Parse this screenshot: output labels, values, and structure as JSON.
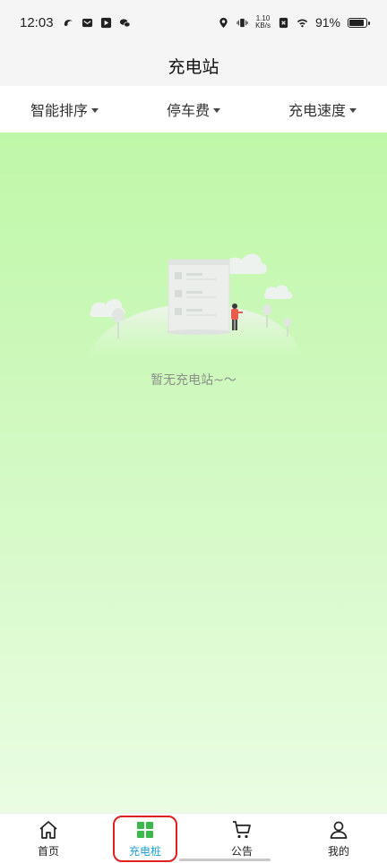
{
  "status_bar": {
    "time": "12:03",
    "net_speed_value": "1.10",
    "net_speed_unit": "KB/s",
    "battery": "91%"
  },
  "header": {
    "title": "充电站"
  },
  "filters": [
    {
      "label": "智能排序"
    },
    {
      "label": "停车费"
    },
    {
      "label": "充电速度"
    }
  ],
  "empty_state": {
    "message": "暂无充电站~〜"
  },
  "bottom_nav": [
    {
      "label": "首页",
      "icon": "home-icon"
    },
    {
      "label": "充电桩",
      "icon": "grid-icon",
      "active": true
    },
    {
      "label": "公告",
      "icon": "cart-icon"
    },
    {
      "label": "我的",
      "icon": "user-icon"
    }
  ],
  "colors": {
    "active_tab": "#1fa0d6",
    "active_tab_icon": "#3cb94b",
    "highlight_box": "#e0201f",
    "content_gradient_top": "#bff7a8",
    "content_gradient_bottom": "#eafde3"
  }
}
